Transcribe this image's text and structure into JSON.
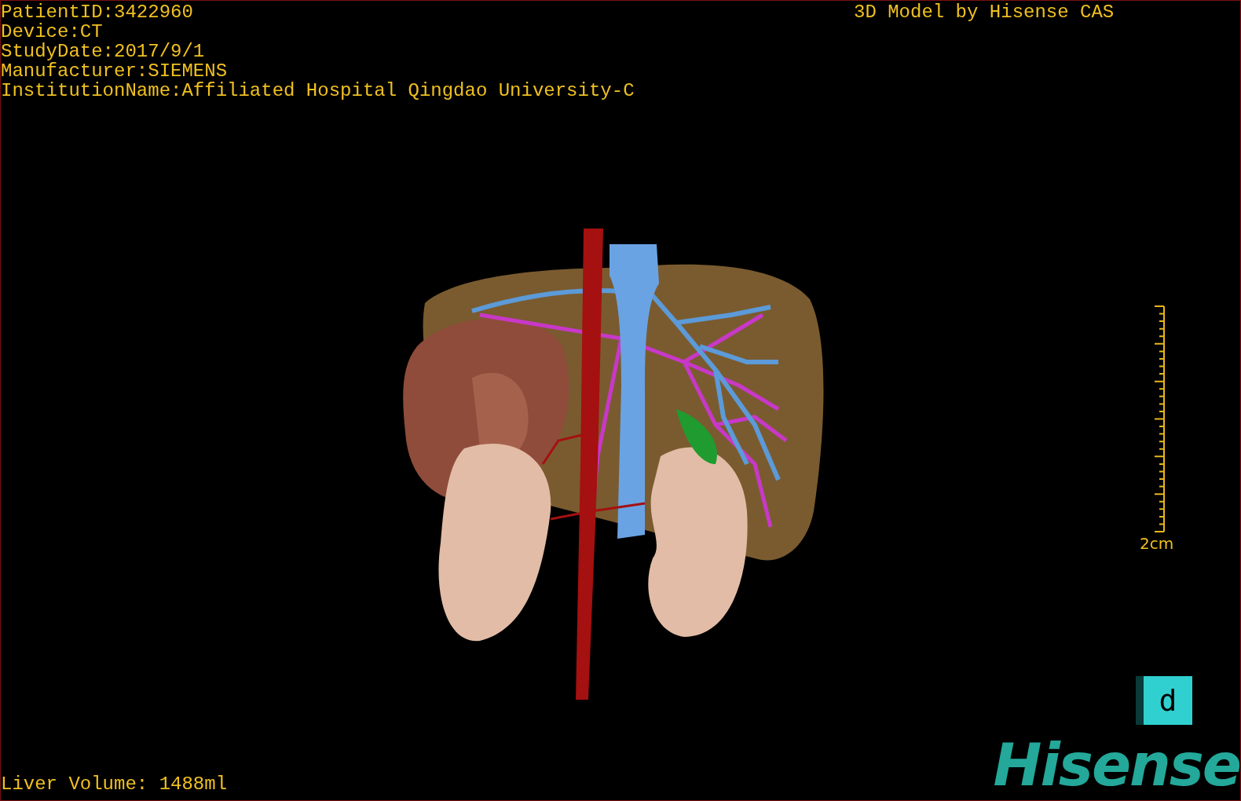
{
  "patient_info": [
    "PatientID:3422960",
    "Device:CT",
    "StudyDate:2017/9/1",
    "Manufacturer:SIEMENS",
    "InstitutionName:Affiliated Hospital Qingdao University-C"
  ],
  "model_credit": "3D Model by Hisense CAS",
  "scale_bar": {
    "label": "2cm"
  },
  "orientation_marker": {
    "label": "d"
  },
  "liver_volume": "Liver Volume: 1488ml",
  "logo": "Hisense"
}
